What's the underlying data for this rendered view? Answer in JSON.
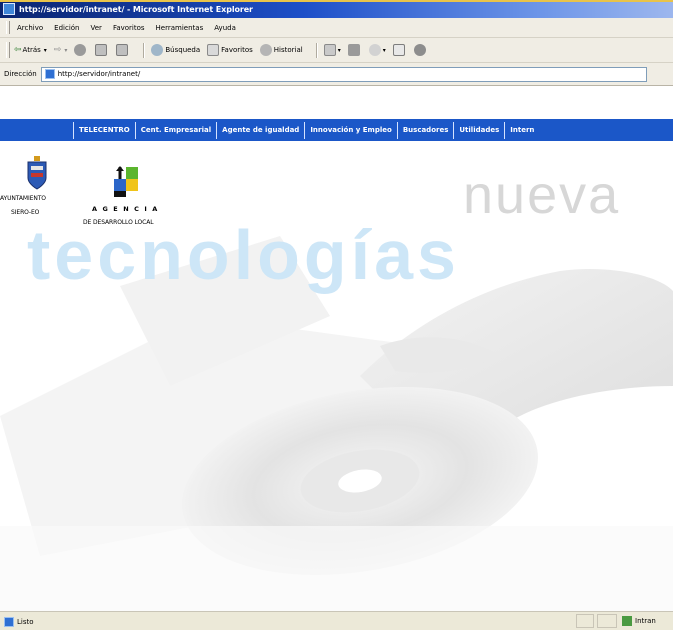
{
  "window": {
    "title": "http://servidor/intranet/ - Microsoft Internet Explorer"
  },
  "menu": {
    "items": [
      "Archivo",
      "Edición",
      "Ver",
      "Favoritos",
      "Herramientas",
      "Ayuda"
    ]
  },
  "toolbar": {
    "back_label": "Atrás",
    "search_label": "Búsqueda",
    "favorites_label": "Favoritos",
    "history_label": "Historial"
  },
  "address": {
    "label": "Dirección",
    "url": "http://servidor/intranet/"
  },
  "nav": {
    "items": [
      "TELECENTRO",
      "Cent. Empresarial",
      "Agente de igualdad",
      "Innovación y Empleo",
      "Buscadores",
      "Utilidades",
      "Intern"
    ]
  },
  "logos": {
    "ayuntamiento_line1": "AYUNTAMIENTO",
    "ayuntamiento_line2": "SIERO-EO",
    "agencia_line1": "A G E N C I A",
    "agencia_line2": "DE DESARROLLO LOCAL"
  },
  "slogan": {
    "word1": "nueva",
    "word2": "tecnologías"
  },
  "status": {
    "text": "Listo",
    "zone": "Intran"
  },
  "colors": {
    "nav_bg": "#1b57c8",
    "title_bar": "#0a2470",
    "chrome": "#f0ede4"
  }
}
